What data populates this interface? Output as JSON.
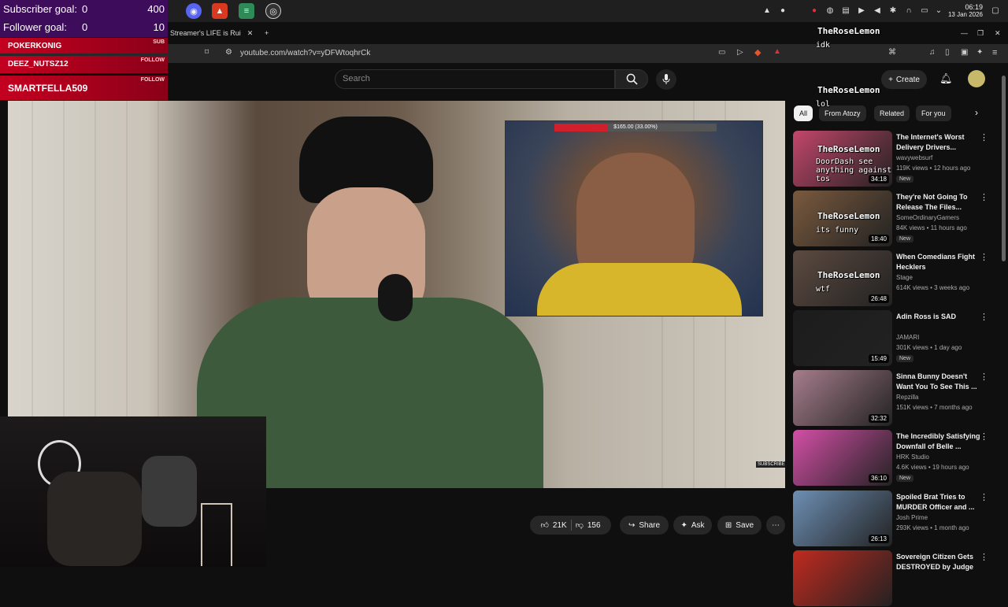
{
  "overlay": {
    "subscriber_goal": {
      "label": "Subscriber goal:",
      "current": "0",
      "target": "400"
    },
    "follower_goal": {
      "label": "Follower goal:",
      "current": "0",
      "target": "10"
    },
    "alerts": [
      {
        "name": "POKERKONIG",
        "tag": "SUB"
      },
      {
        "name": "DEEZ_NUTSZ12",
        "tag": "FOLLOW"
      },
      {
        "name": "SMARTFELLA509",
        "tag": "FOLLOW"
      }
    ]
  },
  "browser": {
    "tab_title": "Streamer's LIFE is Rui",
    "new_tab": "+",
    "url": "youtube.com/watch?v=yDFWtoqhrCk"
  },
  "system": {
    "time": "06:19",
    "date": "13 Jan 2026"
  },
  "youtube": {
    "search_placeholder": "Search",
    "create_label": "Create",
    "donation_text": "$165.00 (33.00%)",
    "donation_fraction": 0.33,
    "subscribe_badge": "SUBSCRIBE",
    "likes": "21K",
    "dislikes": "156",
    "share_label": "Share",
    "ask_label": "Ask",
    "save_label": "Save",
    "chips": [
      "All",
      "From Atozy",
      "Related",
      "For you"
    ],
    "recommendations": [
      {
        "title": "The Internet's Worst Delivery Drivers...",
        "channel": "wavywebsurf",
        "meta": "119K views • 12 hours ago",
        "new": "New",
        "duration": "34:18",
        "color": "#c3466b"
      },
      {
        "title": "They're Not Going To Release The Files...",
        "channel": "SomeOrdinaryGamers",
        "meta": "84K views • 11 hours ago",
        "new": "New",
        "duration": "18:40",
        "color": "#7a5a3e"
      },
      {
        "title": "When Comedians Fight Hecklers",
        "channel": "Stage",
        "meta": "614K views • 3 weeks ago",
        "new": "",
        "duration": "26:48",
        "color": "#5c4a40"
      },
      {
        "title": "Adin Ross is SAD",
        "channel": "JAMARI",
        "meta": "301K views • 1 day ago",
        "new": "New",
        "duration": "15:49",
        "color": "#1c1c1c"
      },
      {
        "title": "Sinna Bunny Doesn't Want You To See This ...",
        "channel": "Repzilla",
        "meta": "151K views • 7 months ago",
        "new": "",
        "duration": "32:32",
        "color": "#a67d8c"
      },
      {
        "title": "The Incredibly Satisfying Downfall of Belle ...",
        "channel": "HRK Studio",
        "meta": "4.6K views • 19 hours ago",
        "new": "New",
        "duration": "36:10",
        "color": "#d34fa6"
      },
      {
        "title": "Spoiled Brat Tries to MURDER Officer and ...",
        "channel": "Josh Prime",
        "meta": "293K views • 1 month ago",
        "new": "",
        "duration": "26:13",
        "color": "#6d8fb4"
      },
      {
        "title": "Sovereign Citizen Gets DESTROYED by Judge",
        "channel": "",
        "meta": "",
        "new": "",
        "duration": "",
        "color": "#c02a1f"
      }
    ]
  },
  "chat": [
    {
      "user": "TheRoseLemon",
      "message": "idk"
    },
    {
      "user": "TheRoseLemon",
      "message": "lol"
    },
    {
      "user": "TheRoseLemon",
      "message": "DoorDash see anything against tos"
    },
    {
      "user": "TheRoseLemon",
      "message": "its funny"
    },
    {
      "user": "TheRoseLemon",
      "message": "wtf"
    }
  ]
}
